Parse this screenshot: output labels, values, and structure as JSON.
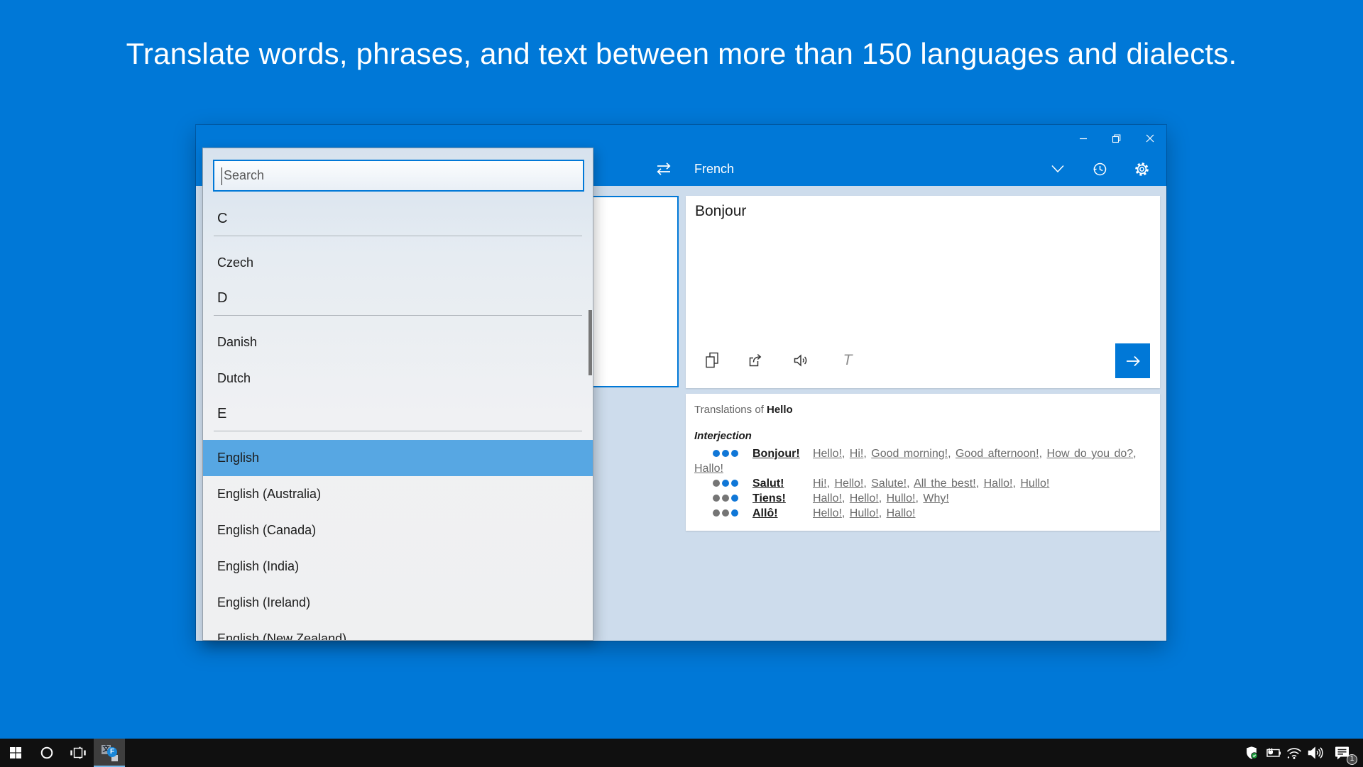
{
  "headline": "Translate words, phrases, and text between more than 150 languages and dialects.",
  "colors": {
    "accent": "#0078D7",
    "selection": "#57A7E3",
    "dot_blue": "#1077D7",
    "dot_gray": "#757575",
    "content_bg": "#CDDCEC",
    "taskbar_bg": "#101010"
  },
  "window": {
    "header": {
      "target_language": "French"
    },
    "output_panel": {
      "text": "Bonjour",
      "font_tool_label": "T"
    },
    "translations": {
      "prefix": "Translations of",
      "word": "Hello",
      "part_of_speech": "Interjection",
      "entries": [
        {
          "term": "Bonjour!",
          "dots": [
            "blue",
            "blue",
            "blue"
          ],
          "equivalents": [
            "Hello!",
            "Hi!",
            "Good morning!",
            "Good afternoon!",
            "How do you do?",
            "Hallo!"
          ]
        },
        {
          "term": "Salut!",
          "dots": [
            "gray",
            "blue",
            "blue"
          ],
          "equivalents": [
            "Hi!",
            "Hello!",
            "Salute!",
            "All the best!",
            "Hallo!",
            "Hullo!"
          ]
        },
        {
          "term": "Tiens!",
          "dots": [
            "gray",
            "gray",
            "blue"
          ],
          "equivalents": [
            "Hallo!",
            "Hello!",
            "Hullo!",
            "Why!"
          ]
        },
        {
          "term": "Allô!",
          "dots": [
            "gray",
            "gray",
            "blue"
          ],
          "equivalents": [
            "Hello!",
            "Hullo!",
            "Hallo!"
          ]
        }
      ]
    },
    "language_picker": {
      "search_placeholder": "Search",
      "groups": [
        {
          "letter": "C",
          "items": [
            {
              "label": "Czech"
            }
          ]
        },
        {
          "letter": "D",
          "items": [
            {
              "label": "Danish"
            },
            {
              "label": "Dutch"
            }
          ]
        },
        {
          "letter": "E",
          "items": [
            {
              "label": "English",
              "selected": true
            },
            {
              "label": "English (Australia)"
            },
            {
              "label": "English (Canada)"
            },
            {
              "label": "English (India)"
            },
            {
              "label": "English (Ireland)"
            },
            {
              "label": "English (New Zealand)"
            }
          ]
        }
      ]
    }
  },
  "taskbar": {
    "translator_icon_glyphs": {
      "square_glyph": "文",
      "circle_glyph": "F"
    },
    "notification_count": "1"
  }
}
